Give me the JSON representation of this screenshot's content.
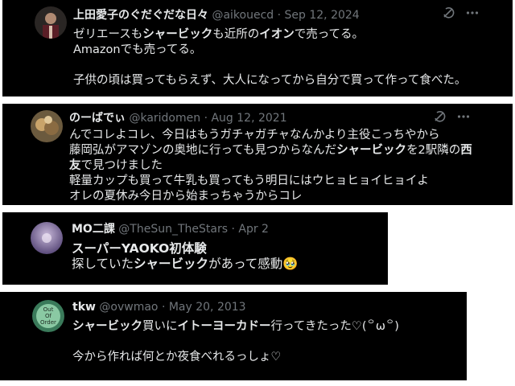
{
  "tweets": [
    {
      "name": "上田愛子のぐだぐだな日々",
      "handle": "@aikouecd",
      "separator": "·",
      "date": "Sep 12, 2024",
      "lines": [
        [
          {
            "t": "ゼリエースも"
          },
          {
            "t": "シャービック",
            "b": true
          },
          {
            "t": "も近所の"
          },
          {
            "t": "イオン",
            "b": true
          },
          {
            "t": "で売ってる。"
          }
        ],
        [
          {
            "t": "Amazonでも売ってる。"
          }
        ],
        [],
        [
          {
            "t": "子供の頃は買ってもらえず、大人になってから自分で買って作って食べた。"
          }
        ]
      ]
    },
    {
      "name": "のーばでぃ",
      "handle": "@karidomen",
      "separator": "·",
      "date": "Aug 12, 2021",
      "lines": [
        [
          {
            "t": "んでコレよコレ、今日はもうガチャガチャなんかより主役こっちやから"
          }
        ],
        [
          {
            "t": "藤岡弘がアマゾンの奥地に行っても見つからなんだ"
          },
          {
            "t": "シャービック",
            "b": true
          },
          {
            "t": "を2駅隣の"
          },
          {
            "t": "西",
            "b": true
          }
        ],
        [
          {
            "t": "友",
            "b": true
          },
          {
            "t": "で見つけました"
          }
        ],
        [
          {
            "t": "軽量カップも買って牛乳も買ってもう明日にはウヒョヒョイヒョイよ"
          }
        ],
        [
          {
            "t": "オレの夏休み今日から始まっちゃうからコレ"
          }
        ]
      ]
    },
    {
      "name": "MO二課",
      "handle": "@TheSun_TheStars",
      "separator": "·",
      "date": "Apr 2",
      "lines": [
        [
          {
            "t": "スーパーYAOKO初体験",
            "b": true
          }
        ],
        [
          {
            "t": "探していた"
          },
          {
            "t": "シャービック",
            "b": true
          },
          {
            "t": "があって感動🥹"
          }
        ]
      ]
    },
    {
      "name": "tkw",
      "handle": "@ovwmao",
      "separator": "·",
      "date": "May 20, 2013",
      "avatar_text": [
        "Out",
        "Of",
        "Order"
      ],
      "lines": [
        [
          {
            "t": "シャービック",
            "b": true
          },
          {
            "t": "買いに"
          },
          {
            "t": "イトーヨーカドー",
            "b": true
          },
          {
            "t": "行ってきたった♡(꒪ω꒪)"
          }
        ],
        [],
        [
          {
            "t": "今から作れば何とか夜食べれるっしょ♡"
          }
        ]
      ]
    }
  ],
  "icons": {
    "grok": "grok-icon",
    "more": "more-icon"
  }
}
